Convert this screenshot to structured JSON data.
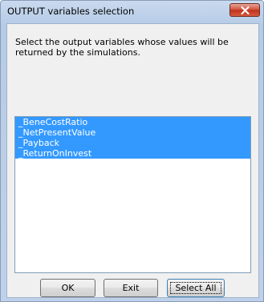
{
  "window": {
    "title": "OUTPUT variables selection"
  },
  "dialog": {
    "prompt": "Select the output variables whose values will be returned by the simulations."
  },
  "variables": [
    {
      "label": "_BeneCostRatio",
      "selected": true
    },
    {
      "label": "_NetPresentValue",
      "selected": true
    },
    {
      "label": "_Payback",
      "selected": true
    },
    {
      "label": "_ReturnOnInvest",
      "selected": true
    }
  ],
  "buttons": {
    "ok": "OK",
    "exit": "Exit",
    "select_all": "Select All"
  },
  "icons": {
    "close": "close-icon"
  },
  "colors": {
    "selection": "#3399ff",
    "close_button": "#c7402a"
  }
}
